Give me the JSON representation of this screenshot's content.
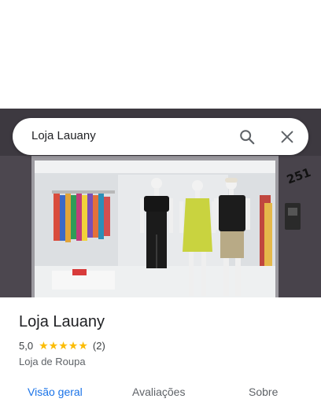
{
  "search": {
    "query": "Loja Lauany"
  },
  "photo": {
    "storefront_number": "251"
  },
  "place": {
    "name": "Loja Lauany",
    "rating": "5,0",
    "stars": 5,
    "review_count": "(2)",
    "category": "Loja de Roupa"
  },
  "tabs": [
    {
      "label": "Visão geral",
      "active": true
    },
    {
      "label": "Avaliações",
      "active": false
    },
    {
      "label": "Sobre",
      "active": false
    }
  ],
  "colors": {
    "accent": "#1a73e8",
    "star": "#fbbc04"
  }
}
